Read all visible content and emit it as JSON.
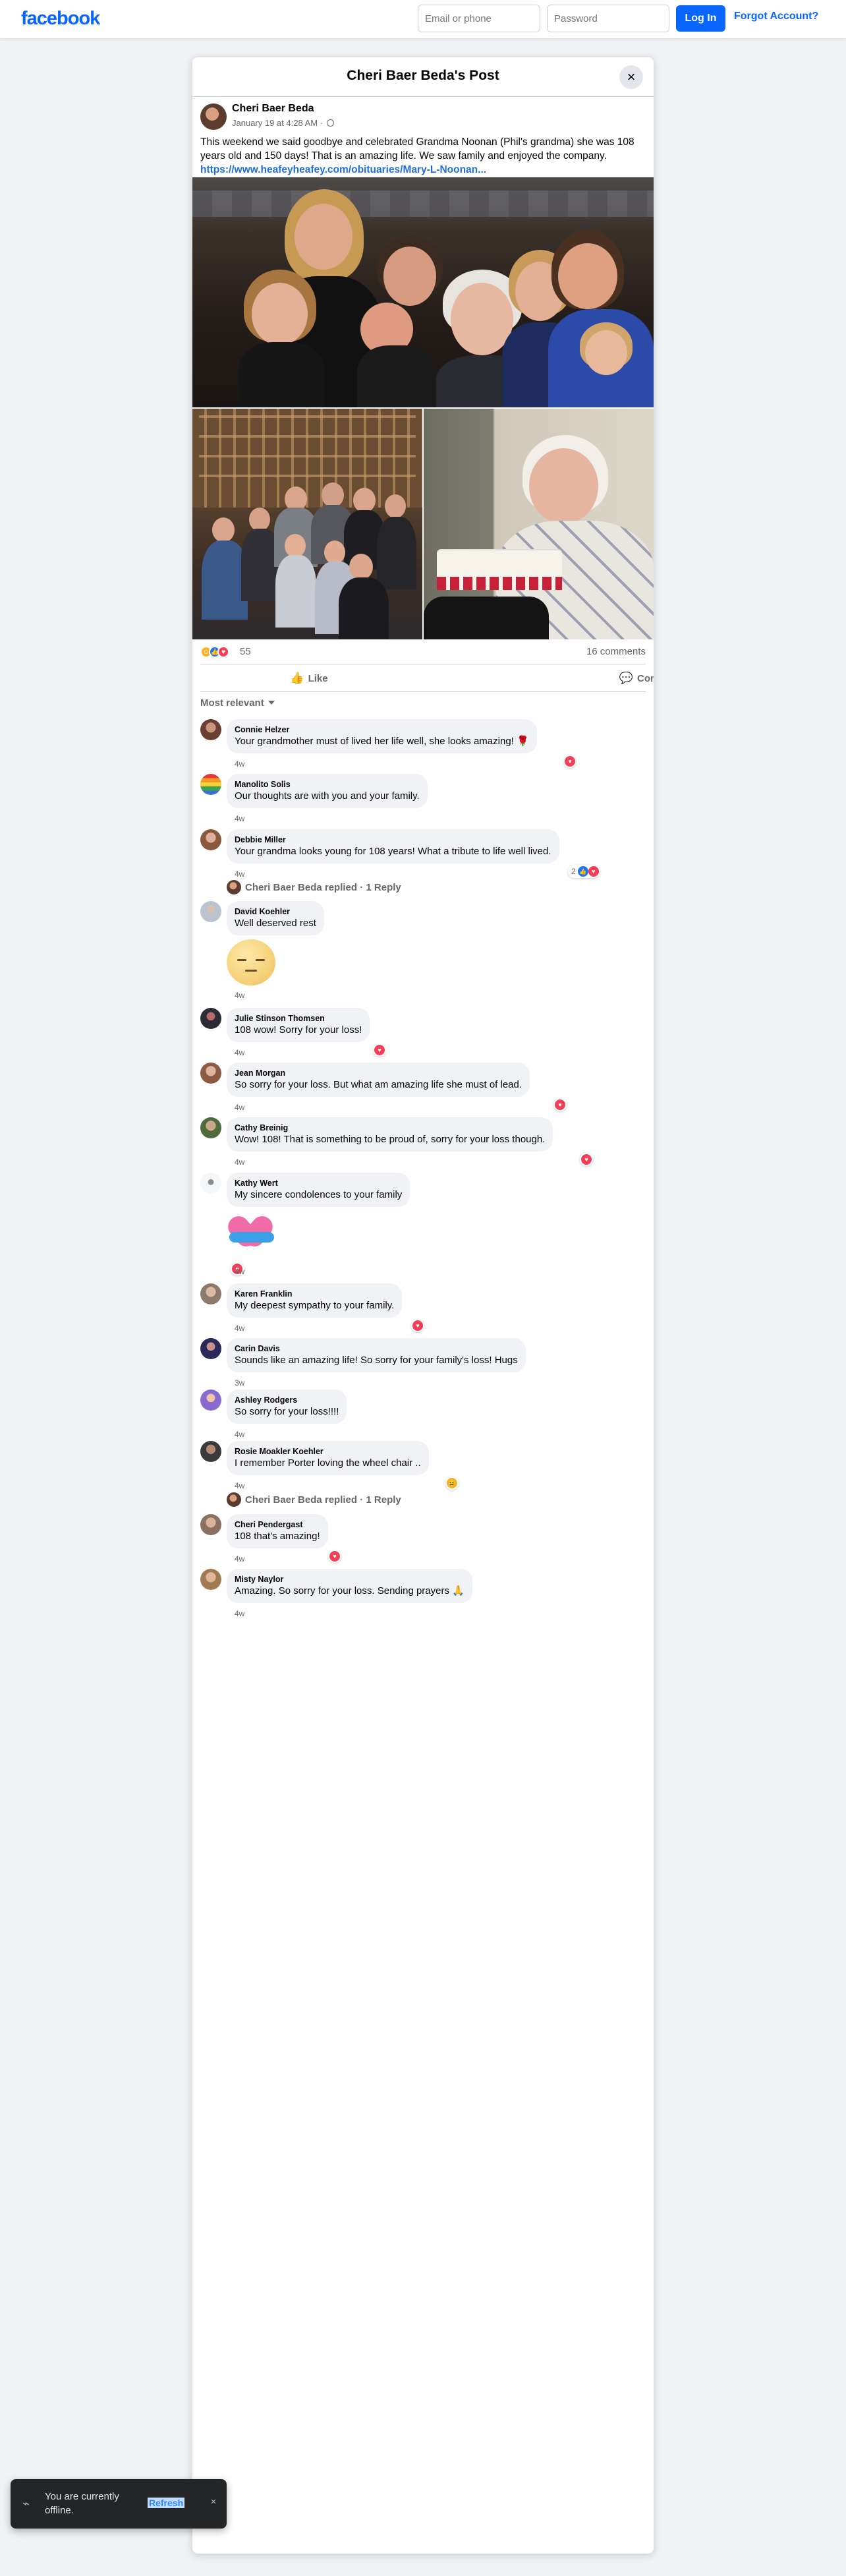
{
  "topbar": {
    "logo": "facebook",
    "email_placeholder": "Email or phone",
    "password_placeholder": "Password",
    "login_label": "Log In",
    "forgot_label": "Forgot Account?"
  },
  "dialog": {
    "title": "Cheri Baer Beda's Post",
    "close_icon": "×"
  },
  "post": {
    "author": "Cheri Baer Beda",
    "date": "January 19 at 4:28 AM ·",
    "text": "This weekend we said goodbye and celebrated Grandma Noonan (Phil's grandma) she was 108 years old and 150 days! That is an amazing life. We saw family and enjoyed the company. ",
    "link": "https://www.heafeyheafey.com/obituaries/Mary-L-Noonan...",
    "reaction_count": "55",
    "comment_count": "16 comments",
    "like_label": "Like",
    "comment_label": "Comment",
    "like_icon": "👍",
    "comment_icon": "💬",
    "sort_label": "Most relevant"
  },
  "comments": [
    {
      "name": "Connie Helzer",
      "text": "Your grandmother must of lived her life well, she looks amazing! 🌹",
      "time": "4w"
    },
    {
      "name": "Manolito Solis",
      "text": "Our thoughts are with you and your family.",
      "time": "4w"
    },
    {
      "name": "Debbie Miller",
      "text": "Your grandma looks young for 108 years! What a tribute to life well lived.",
      "time": "4w",
      "react_count": "2"
    },
    {
      "name": "David Koehler",
      "text": "Well deserved rest",
      "time": "4w"
    },
    {
      "name": "Julie Stinson Thomsen",
      "text": "108 wow! Sorry for your loss!",
      "time": "4w"
    },
    {
      "name": "Jean Morgan",
      "text": "So sorry for your loss. But what am amazing life she must of lead.",
      "time": "4w"
    },
    {
      "name": "Cathy Breinig",
      "text": "Wow! 108! That is something to be proud of, sorry for your loss though.",
      "time": "4w"
    },
    {
      "name": "Kathy Wert",
      "text": "My sincere condolences to your family",
      "time": "4w"
    },
    {
      "name": "Karen Franklin",
      "text": "My deepest sympathy to your family.",
      "time": "4w"
    },
    {
      "name": "Carin Davis",
      "text": "Sounds like an amazing life! So sorry for your family's loss! Hugs",
      "time": "3w"
    },
    {
      "name": "Ashley Rodgers",
      "text": "So sorry for your loss!!!!",
      "time": "4w"
    },
    {
      "name": "Rosie Moakler Koehler",
      "text": "I remember Porter loving the wheel chair ..",
      "time": "4w"
    },
    {
      "name": "Cheri Pendergast",
      "text": "108 that's amazing!",
      "time": "4w"
    },
    {
      "name": "Misty Naylor",
      "text": "Amazing. So sorry for your loss. Sending prayers 🙏",
      "time": "4w"
    }
  ],
  "replies": [
    {
      "label": "Cheri Baer Beda replied · 1 Reply"
    },
    {
      "label": "Cheri Baer Beda replied · 1 Reply"
    }
  ],
  "toast": {
    "text": "You are currently offline.",
    "refresh_label": "Refresh",
    "close_icon": "×",
    "icon": "wifi-off-icon"
  },
  "colors": {
    "brand": "#0866ff",
    "link": "#216fdb",
    "heart": "#f33e58",
    "like": "#1877f2"
  }
}
